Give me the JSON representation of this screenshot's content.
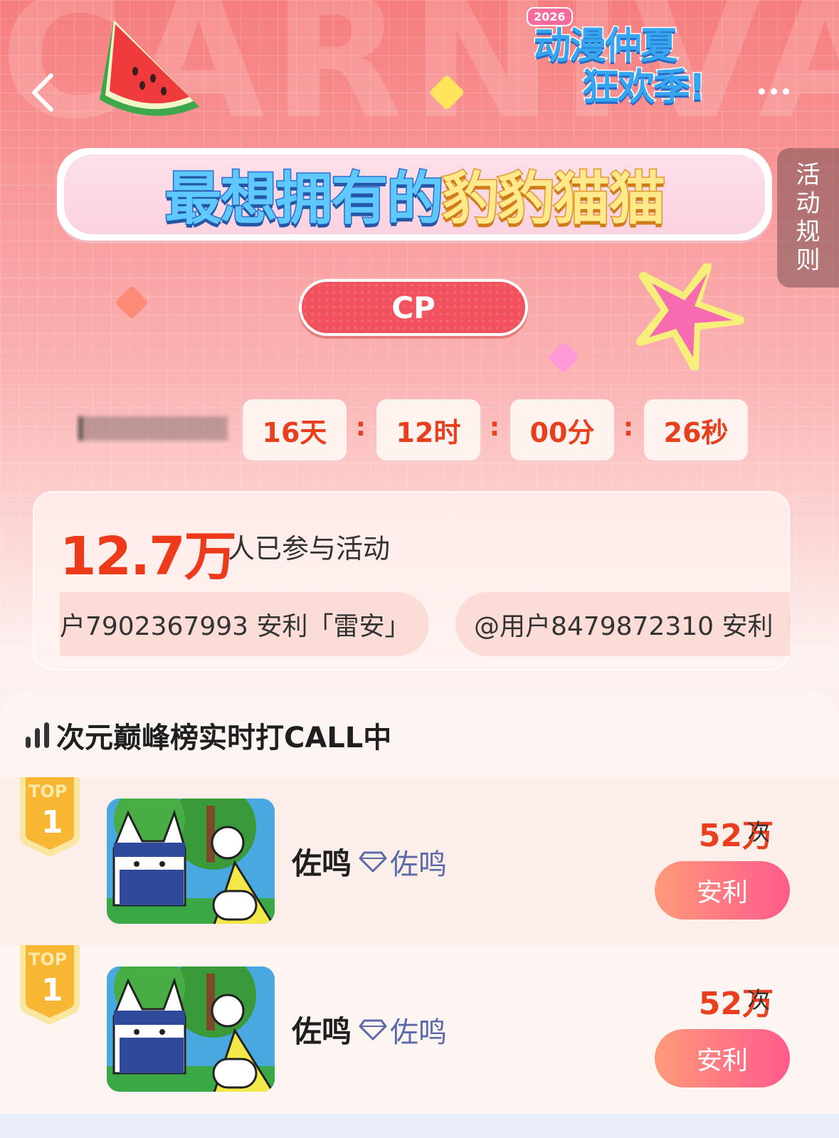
{
  "header": {
    "back_icon": "chevron-left-icon",
    "more_icon": "more-dots-icon",
    "logo": {
      "year": "2026",
      "line1": "动漫仲夏",
      "line2": "狂欢季!"
    },
    "rules_tab": "活动规则"
  },
  "hero": {
    "title_part1": "最想拥有的",
    "title_part2": "豹豹猫猫",
    "category_pill": "CP"
  },
  "countdown": {
    "days": "16天",
    "hours": "12时",
    "minutes": "00分",
    "seconds": "26秒",
    "separator": ":"
  },
  "stats": {
    "participants": "12.7万",
    "participants_text": "人已参与活动",
    "ticker": [
      "户7902367993 安利「雷安」",
      "@用户8479872310 安利「"
    ]
  },
  "ranking": {
    "title": "次元巅峰榜实时打CALL中",
    "rows": [
      {
        "badge_top": "TOP",
        "badge_rank": "1",
        "name": "佐鸣",
        "tag": "佐鸣",
        "count": "52万",
        "unit": "次",
        "button": "安利"
      },
      {
        "badge_top": "TOP",
        "badge_rank": "1",
        "name": "佐鸣",
        "tag": "佐鸣",
        "count": "52万",
        "unit": "次",
        "button": "安利"
      }
    ]
  },
  "colors": {
    "accent_red": "#e8401f",
    "pill_red": "#f1525d",
    "button_gradient_start": "#ff9a7a",
    "button_gradient_end": "#ff5a8c"
  }
}
